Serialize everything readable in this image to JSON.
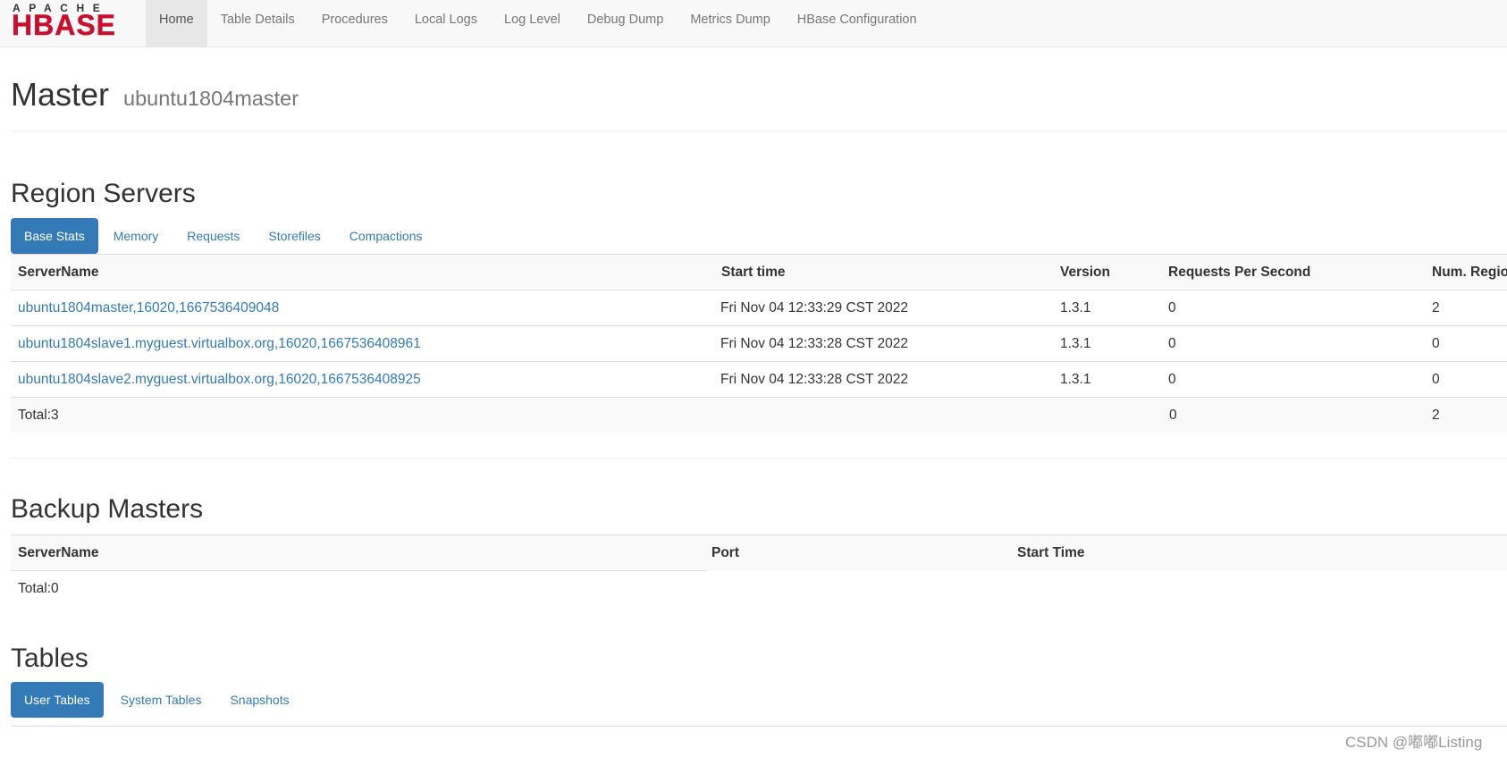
{
  "logo": {
    "top": "APACHE",
    "main": "HBASE"
  },
  "nav": {
    "items": [
      "Home",
      "Table Details",
      "Procedures",
      "Local Logs",
      "Log Level",
      "Debug Dump",
      "Metrics Dump",
      "HBase Configuration"
    ],
    "active": "Home"
  },
  "header": {
    "title": "Master",
    "host": "ubuntu1804master"
  },
  "region_servers": {
    "heading": "Region Servers",
    "tabs": [
      "Base Stats",
      "Memory",
      "Requests",
      "Storefiles",
      "Compactions"
    ],
    "columns": [
      "ServerName",
      "Start time",
      "Version",
      "Requests Per Second",
      "Num. Regions"
    ],
    "rows": [
      {
        "server": "ubuntu1804master,16020,1667536409048",
        "start": "Fri Nov 04 12:33:29 CST 2022",
        "version": "1.3.1",
        "rps": "0",
        "regions": "2"
      },
      {
        "server": "ubuntu1804slave1.myguest.virtualbox.org,16020,1667536408961",
        "start": "Fri Nov 04 12:33:28 CST 2022",
        "version": "1.3.1",
        "rps": "0",
        "regions": "0"
      },
      {
        "server": "ubuntu1804slave2.myguest.virtualbox.org,16020,1667536408925",
        "start": "Fri Nov 04 12:33:28 CST 2022",
        "version": "1.3.1",
        "rps": "0",
        "regions": "0"
      }
    ],
    "total": {
      "label": "Total:3",
      "rps": "0",
      "regions": "2"
    }
  },
  "backup_masters": {
    "heading": "Backup Masters",
    "columns": [
      "ServerName",
      "Port",
      "Start Time"
    ],
    "total": "Total:0"
  },
  "tables": {
    "heading": "Tables",
    "tabs": [
      "User Tables",
      "System Tables",
      "Snapshots"
    ]
  },
  "watermark": "CSDN @嘟嘟Listing",
  "colors": {
    "brand": "#c8102e",
    "link": "#337ab7",
    "active_pill": "#337ab7"
  }
}
